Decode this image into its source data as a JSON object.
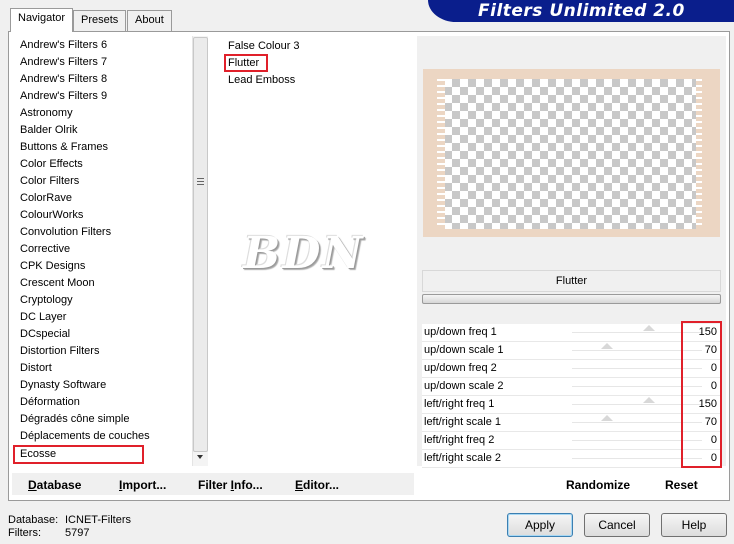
{
  "tabs": [
    {
      "label": "Navigator",
      "active": true
    },
    {
      "label": "Presets",
      "active": false
    },
    {
      "label": "About",
      "active": false
    }
  ],
  "app_title": "Filters Unlimited 2.0",
  "categories": [
    "Andrew's Filters 6",
    "Andrew's Filters 7",
    "Andrew's Filters 8",
    "Andrew's Filters 9",
    "Astronomy",
    "Balder Olrik",
    "Buttons & Frames",
    "Color Effects",
    "Color Filters",
    "ColorRave",
    "ColourWorks",
    "Convolution Filters",
    "Corrective",
    "CPK Designs",
    "Crescent Moon",
    "Cryptology",
    "DC Layer",
    "DCspecial",
    "Distortion Filters",
    "Distort",
    "Dynasty Software",
    "Déformation",
    "Dégradés cône simple",
    "Déplacements de couches",
    "Ecosse"
  ],
  "selected_category": "Ecosse",
  "filters": [
    "False Colour 3",
    "Flutter",
    "Lead Emboss"
  ],
  "selected_filter": "Flutter",
  "watermark": "BDN",
  "preview_border_color": "#ecd6c3",
  "current_filter_name": "Flutter",
  "params": [
    {
      "label": "up/down freq 1",
      "value": "150",
      "level": 0.59
    },
    {
      "label": "up/down scale 1",
      "value": "70",
      "level": 0.27
    },
    {
      "label": "up/down freq 2",
      "value": "0",
      "level": 0
    },
    {
      "label": "up/down scale 2",
      "value": "0",
      "level": 0
    },
    {
      "label": "left/right freq 1",
      "value": "150",
      "level": 0.59
    },
    {
      "label": "left/right scale 1",
      "value": "70",
      "level": 0.27
    },
    {
      "label": "left/right freq 2",
      "value": "0",
      "level": 0
    },
    {
      "label": "left/right scale 2",
      "value": "0",
      "level": 0
    }
  ],
  "actions": {
    "randomize": "Randomize",
    "reset": "Reset"
  },
  "toolbar": {
    "database_u": "D",
    "database_rest": "atabase",
    "import_u": "I",
    "import_rest": "mport...",
    "filterinfo_pre": "Filter ",
    "filterinfo_u": "I",
    "filterinfo_rest": "nfo...",
    "editor_u": "E",
    "editor_rest": "ditor..."
  },
  "footer": {
    "database_label": "Database:",
    "database_value": "ICNET-Filters",
    "filters_label": "Filters:",
    "filters_value": "5797"
  },
  "buttons": {
    "apply": "Apply",
    "cancel": "Cancel",
    "help": "Help"
  },
  "highlight_color": "#e0202a"
}
